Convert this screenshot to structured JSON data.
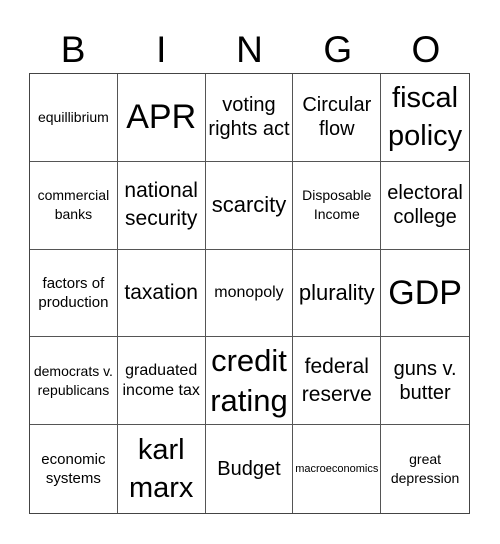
{
  "header": {
    "letters": [
      "B",
      "I",
      "N",
      "G",
      "O"
    ]
  },
  "cells": [
    "equillibrium",
    "APR",
    "voting rights act",
    "Circular flow",
    "fiscal policy",
    "commercial banks",
    "national security",
    "scarcity",
    "Disposable Income",
    "electoral college",
    "factors of production",
    "taxation",
    "monopoly",
    "plurality",
    "GDP",
    "democrats v. republicans",
    "graduated income tax",
    "credit rating",
    "federal reserve",
    "guns v. butter",
    "economic systems",
    "karl marx",
    "Budget",
    "macroeconomics",
    "great depression"
  ]
}
